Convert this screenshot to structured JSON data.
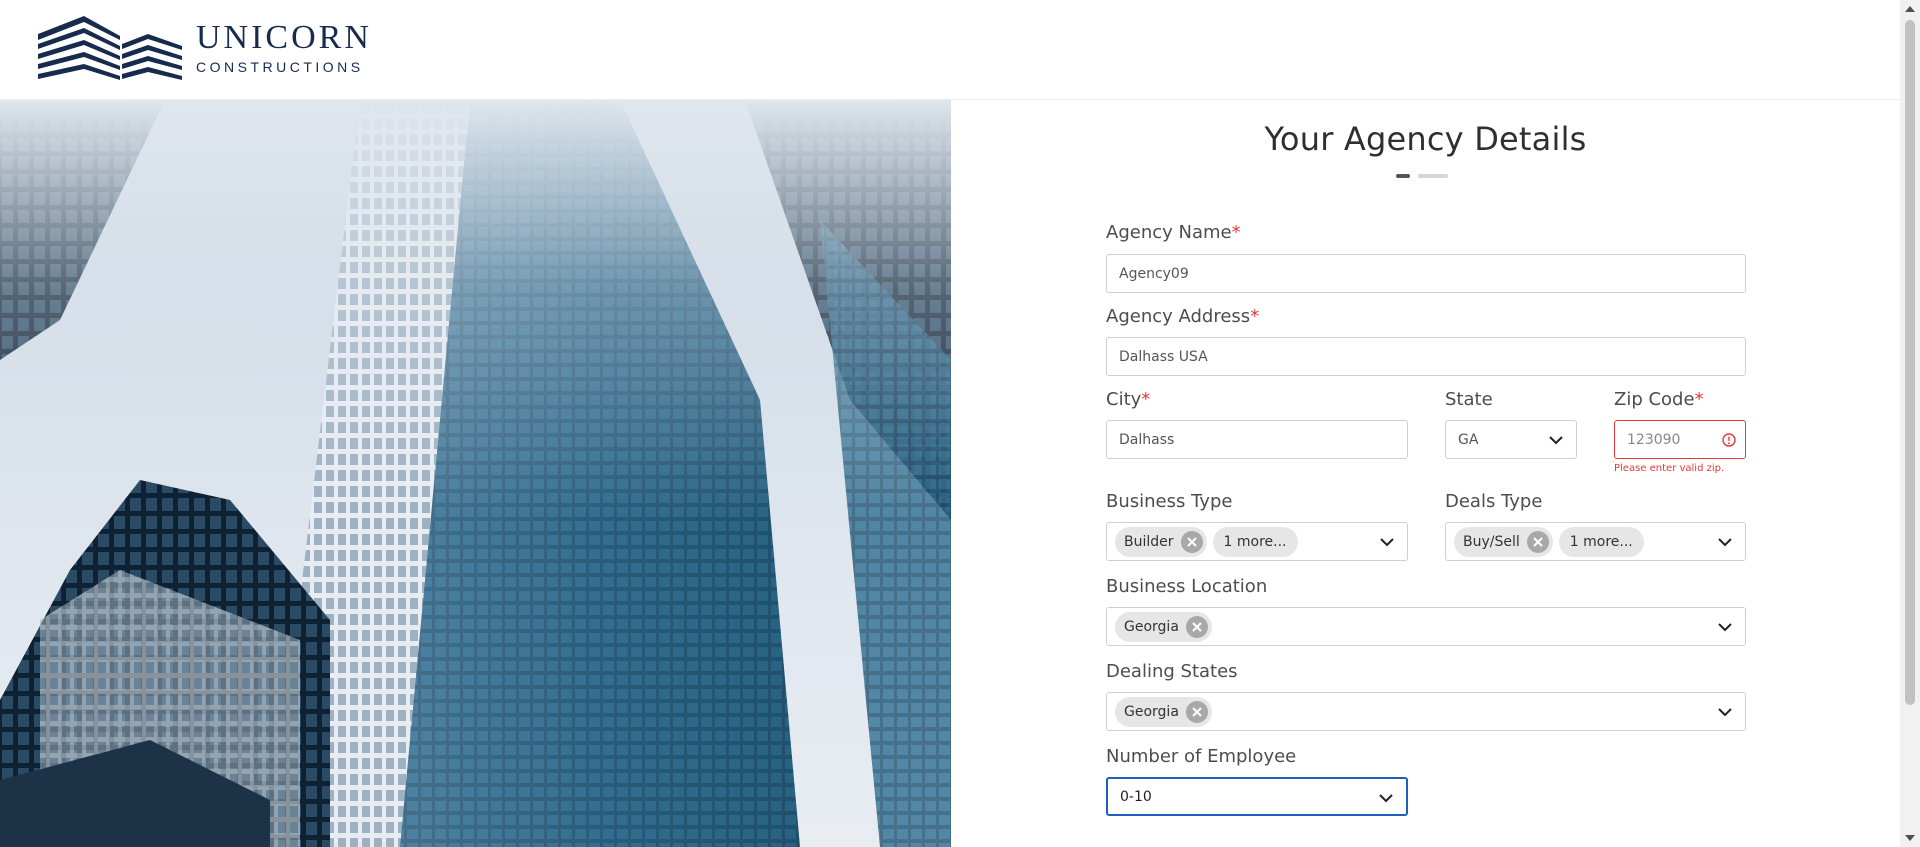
{
  "brand": {
    "title": "UNICORN",
    "subtitle": "CONSTRUCTIONS",
    "logo_icon": "building-stack-icon",
    "color": "#162b4d"
  },
  "form": {
    "title": "Your Agency Details",
    "agency_name": {
      "label": "Agency Name",
      "required": "*",
      "value": "Agency09"
    },
    "agency_address": {
      "label": "Agency Address",
      "required": "*",
      "value": "Dalhass USA"
    },
    "city": {
      "label": "City",
      "required": "*",
      "value": "Dalhass"
    },
    "state": {
      "label": "State",
      "value": "GA"
    },
    "zip": {
      "label": "Zip Code",
      "required": "*",
      "value": "123090",
      "error": "Please enter valid zip."
    },
    "business_type": {
      "label": "Business Type",
      "chips": [
        "Builder"
      ],
      "more": "1 more..."
    },
    "deals_type": {
      "label": "Deals Type",
      "chips": [
        "Buy/Sell"
      ],
      "more": "1 more..."
    },
    "business_location": {
      "label": "Business Location",
      "chips": [
        "Georgia"
      ]
    },
    "dealing_states": {
      "label": "Dealing States",
      "chips": [
        "Georgia"
      ]
    },
    "employees": {
      "label": "Number of Employee",
      "value": "0-10"
    }
  },
  "colors": {
    "error": "#e53935",
    "focus": "#1f5fbf",
    "chip": "#e6e6e6"
  }
}
